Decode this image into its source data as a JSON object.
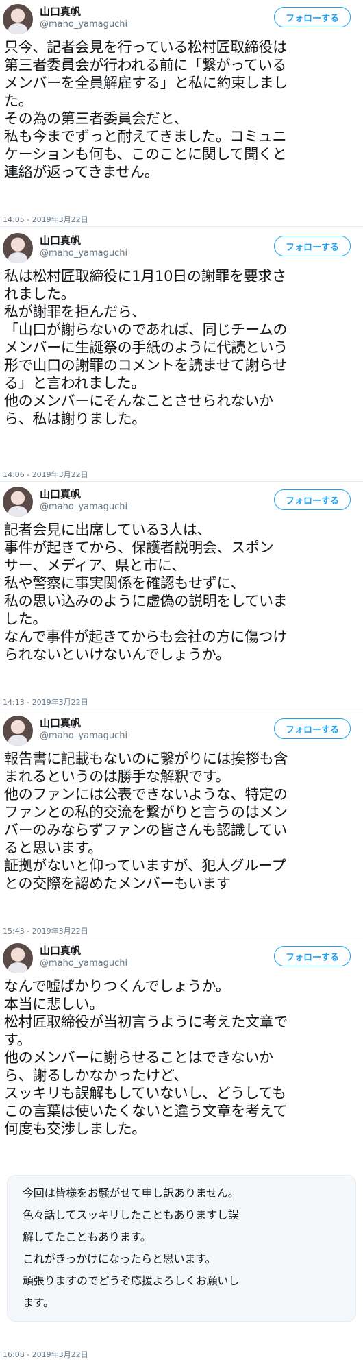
{
  "user": {
    "name": "山口真帆",
    "handle": "@maho_yamaguchi",
    "follow_label": "フォローする"
  },
  "tweets": [
    {
      "lines": [
        "只今、記者会見を行っている松村匠取締役は",
        "第三者委員会が行われる前に「繋がっている",
        "メンバーを全員解雇する」と私に約束しまし",
        "た。",
        "その為の第三者委員会だと、",
        "私も今までずっと耐えてきました。コミュニ",
        "ケーションも何も、このことに関して聞くと",
        "連絡が返ってきません。"
      ],
      "timestamp": "14:05 - 2019年3月22日"
    },
    {
      "lines": [
        "私は松村匠取締役に1月10日の謝罪を要求さ",
        "れました。",
        "私が謝罪を拒んだら、",
        "「山口が謝らないのであれば、同じチームの",
        "メンバーに生誕祭の手紙のように代読という",
        "形で山口の謝罪のコメントを読ませて謝らせ",
        "る」と言われました。",
        "他のメンバーにそんなことさせられないか",
        "ら、私は謝りました。"
      ],
      "timestamp": "14:06 - 2019年3月22日"
    },
    {
      "lines": [
        "記者会見に出席している3人は、",
        "事件が起きてから、保護者説明会、スポン",
        "サー、メディア、県と市に、",
        "私や警察に事実関係を確認もせずに、",
        "私の思い込みのように虚偽の説明をしていま",
        "した。",
        "なんで事件が起きてからも会社の方に傷つけ",
        "られないといけないんでしょうか。"
      ],
      "timestamp": "14:13 - 2019年3月22日"
    },
    {
      "lines": [
        "報告書に記載もないのに繋がりには挨拶も含",
        "まれるというのは勝手な解釈です。",
        "他のファンには公表できないような、特定の",
        "ファンとの私的交流を繋がりと言うのはメン",
        "バーのみならずファンの皆さんも認識してい",
        "ると思います。",
        "証拠がないと仰っていますが、犯人グループ",
        "との交際を認めたメンバーもいます"
      ],
      "timestamp": "15:43 - 2019年3月22日"
    },
    {
      "lines": [
        "なんで嘘ばかりつくんでしょうか。",
        "本当に悲しい。",
        "松村匠取締役が当初言うように考えた文章で",
        "す。",
        "他のメンバーに謝らせることはできないか",
        "ら、謝るしかなかったけど、",
        "スッキリも誤解もしていないし、どうしても",
        "この言葉は使いたくないと違う文章を考えて",
        "何度も交渉しました。"
      ],
      "quote": [
        "今回は皆様をお騒がせて申し訳ありません。",
        "色々話してスッキリしたこともありますし誤",
        "解してたこともあります。",
        "これがきっかけになったらと思います。",
        "頑張りますのでどうぞ応援よろしくお願いし",
        "ます。"
      ],
      "timestamp": "16:08 - 2019年3月22日"
    }
  ]
}
